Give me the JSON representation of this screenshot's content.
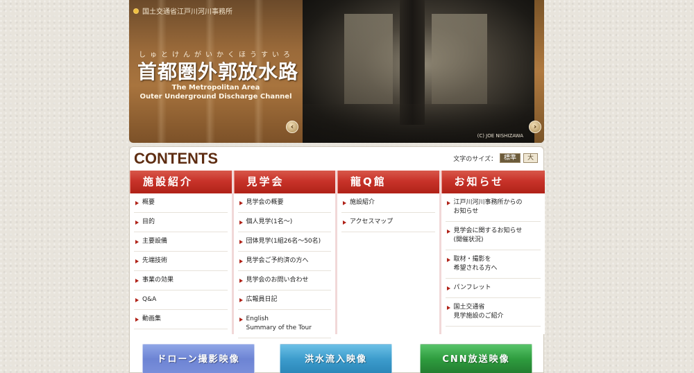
{
  "hero": {
    "agency": "国土交通省江戸川河川事務所",
    "ruby": "しゅとけんがいかくほうすいろ",
    "title_jp": "首都圏外郭放水路",
    "title_en_line1": "The Metropolitan Area",
    "title_en_line2": "Outer Underground Discharge Channel",
    "copyright": "(C) JOE NISHIZAWA",
    "prev_symbol": "‹",
    "next_symbol": "›"
  },
  "contents": {
    "heading": "CONTENTS",
    "font_size_label": "文字のサイズ：",
    "font_std": "標準",
    "font_large": "大"
  },
  "columns": [
    {
      "title": "施設紹介",
      "items": [
        [
          "概要"
        ],
        [
          "目的"
        ],
        [
          "主要設備"
        ],
        [
          "先端技術"
        ],
        [
          "事業の効果"
        ],
        [
          "Q&A"
        ],
        [
          "動画集"
        ]
      ]
    },
    {
      "title": "見学会",
      "items": [
        [
          "見学会の概要"
        ],
        [
          "個人見学(1名〜)"
        ],
        [
          "団体見学(1組26名〜50名)"
        ],
        [
          "見学会ご予約済の方へ"
        ],
        [
          "見学会のお問い合わせ"
        ],
        [
          "広報員日記"
        ],
        [
          "English",
          "Summary of the Tour"
        ]
      ]
    },
    {
      "title": "龍Q館",
      "items": [
        [
          "施設紹介"
        ],
        [
          "アクセスマップ"
        ]
      ]
    },
    {
      "title": "お知らせ",
      "items": [
        [
          "江戸川河川事務所からの",
          "お知らせ"
        ],
        [
          "見学会に関するお知らせ",
          "(開催状況)"
        ],
        [
          "取材・撮影を",
          "希望される方へ"
        ],
        [
          "パンフレット"
        ],
        [
          "国土交通省",
          "見学施設のご紹介"
        ]
      ]
    }
  ],
  "banners": {
    "drone": "ドローン撮影映像",
    "flood": "洪水流入映像",
    "cnn": "CNN放送映像"
  },
  "colors": {
    "accent_red": "#c8332a",
    "heading_brown": "#5e2d12"
  }
}
